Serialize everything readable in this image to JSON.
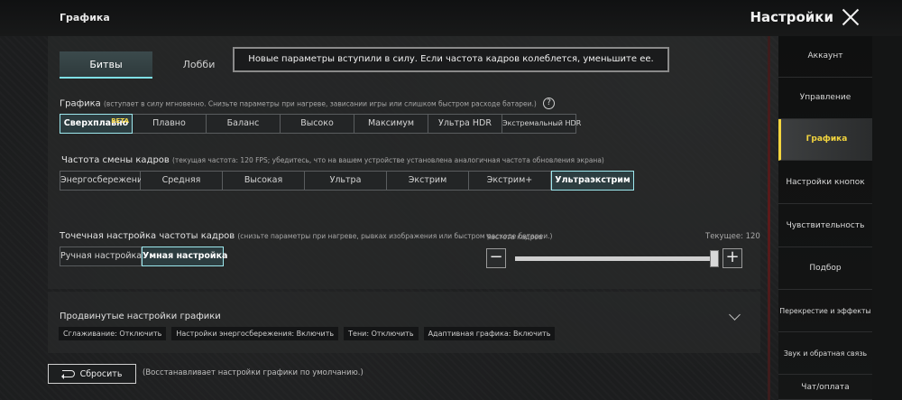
{
  "header": {
    "page_title": "Графика",
    "settings_title": "Настройки"
  },
  "tabs": [
    {
      "label": "Битвы",
      "active": true
    },
    {
      "label": "Лобби",
      "active": false
    }
  ],
  "notice": "Новые параметры вступили в силу. Если частота кадров колеблется, уменьшите ее.",
  "graphics": {
    "label": "Графика",
    "sublabel": "(вступает в силу мгновенно. Снизьте параметры при нагреве, зависании игры или слишком быстром расходе батареи.)",
    "help": "?",
    "options": [
      "Сверхплавно",
      "Плавно",
      "Баланс",
      "Высоко",
      "Максимум",
      "Ультра HDR",
      "Экстремальный HDR"
    ],
    "selected": "Сверхплавно",
    "beta": "BETA"
  },
  "framerate": {
    "label": "Частота смены кадров",
    "sublabel": "(текущая частота: 120 FPS; убедитесь, что на вашем устройстве установлена аналогичная частота обновления экрана)",
    "options": [
      "Энергосбережение",
      "Средняя",
      "Высокая",
      "Ультра",
      "Экстрим",
      "Экстрим+",
      "Ультраэкстрим"
    ],
    "selected": "Ультраэкстрим"
  },
  "fine_tune": {
    "label": "Точечная настройка частоты кадров",
    "sublabel": "(снизьте параметры при нагреве, рывках изображения или быстром расходе батареи.)",
    "modes": [
      "Ручная настройка",
      "Умная настройка"
    ],
    "selected_mode": "Умная настройка",
    "slider_label": "Частота кадров",
    "current_label": "Текущее: 120",
    "minus": "−",
    "plus": "+",
    "slider_value_fraction": 1.0
  },
  "advanced": {
    "title": "Продвинутые настройки графики",
    "chips": [
      "Сглаживание: Отключить",
      "Настройки энергосбережения: Включить",
      "Тени: Отключить",
      "Адаптивная графика: Включить"
    ]
  },
  "reset": {
    "label": "Сбросить",
    "note": "(Восстанавливает настройки графики по умолчанию.)"
  },
  "sidebar": {
    "items": [
      {
        "label": "Аккаунт",
        "active": false
      },
      {
        "label": "Управление",
        "active": false
      },
      {
        "label": "Графика",
        "active": true
      },
      {
        "label": "Настройки кнопок",
        "active": false
      },
      {
        "label": "Чувствительность",
        "active": false
      },
      {
        "label": "Подбор",
        "active": false
      },
      {
        "label": "Перекрестие и эффекты",
        "active": false
      },
      {
        "label": "Звук и обратная связь",
        "active": false
      },
      {
        "label": "Чат/оплата",
        "active": false
      }
    ]
  },
  "colors": {
    "accent_cyan": "#9de8ee",
    "sidebar_active": "#f3d53e",
    "beta": "#f5d84a"
  }
}
